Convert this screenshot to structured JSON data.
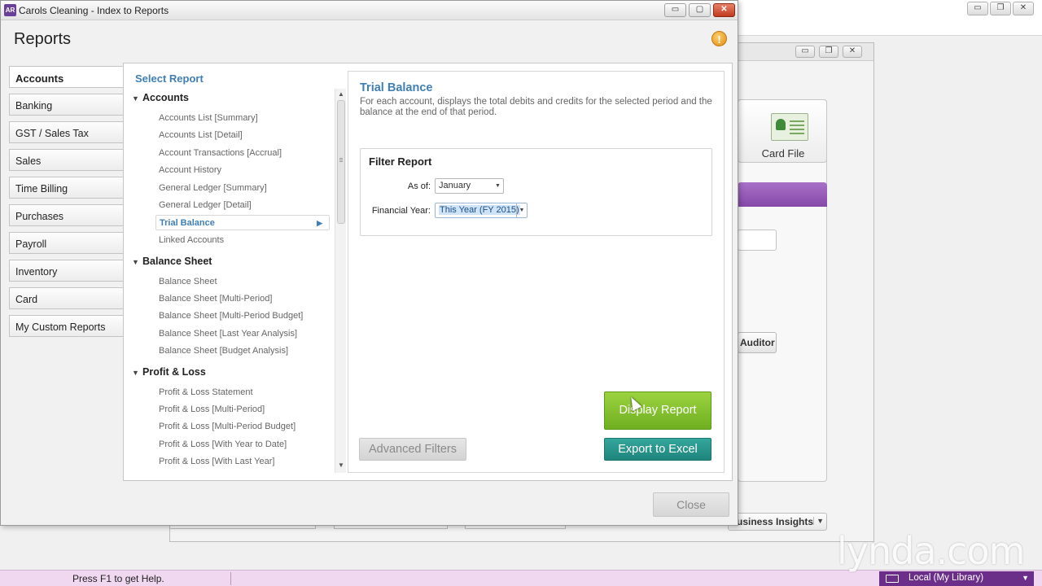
{
  "background_app": {
    "card_file_label": "Card File",
    "auditor_label": "Auditor",
    "insights_label": "usiness Insights"
  },
  "window": {
    "icon_label": "AR",
    "title": "Carols Cleaning - Index to Reports",
    "minimize": "▭",
    "maximize": "▢",
    "close": "✕"
  },
  "header": {
    "title": "Reports",
    "help_glyph": "!"
  },
  "categories": [
    {
      "label": "Accounts",
      "active": true
    },
    {
      "label": "Banking"
    },
    {
      "label": "GST / Sales Tax"
    },
    {
      "label": "Sales"
    },
    {
      "label": "Time Billing"
    },
    {
      "label": "Purchases"
    },
    {
      "label": "Payroll"
    },
    {
      "label": "Inventory"
    },
    {
      "label": "Card"
    },
    {
      "label": "My Custom Reports"
    }
  ],
  "report_list": {
    "heading": "Select Report",
    "groups": [
      {
        "label": "Accounts",
        "items": [
          "Accounts List [Summary]",
          "Accounts List [Detail]",
          "Account Transactions [Accrual]",
          "Account History",
          "General Ledger [Summary]",
          "General Ledger [Detail]",
          "Trial Balance",
          "Linked Accounts"
        ]
      },
      {
        "label": "Balance Sheet",
        "items": [
          "Balance Sheet",
          "Balance Sheet [Multi-Period]",
          "Balance Sheet [Multi-Period Budget]",
          "Balance Sheet [Last Year Analysis]",
          "Balance Sheet [Budget Analysis]"
        ]
      },
      {
        "label": "Profit & Loss",
        "items": [
          "Profit & Loss Statement",
          "Profit & Loss [Multi-Period]",
          "Profit & Loss [Multi-Period Budget]",
          "Profit & Loss [With Year to Date]",
          "Profit & Loss [With Last Year]"
        ]
      }
    ],
    "selected": "Trial Balance"
  },
  "detail": {
    "title": "Trial Balance",
    "description": "For each account, displays the total debits and credits for the selected period and the balance at the end of that period.",
    "filter": {
      "title": "Filter Report",
      "as_of_label": "As of:",
      "as_of_value": "January",
      "fy_label": "Financial Year:",
      "fy_value": "This Year (FY 2015)"
    }
  },
  "buttons": {
    "display_report": "Display Report",
    "export_excel": "Export to Excel",
    "advanced_filters": "Advanced Filters",
    "close": "Close"
  },
  "status": {
    "help_text": "Press F1 to get Help.",
    "library": "Local (My Library)"
  },
  "watermark": "lynda.com",
  "colors": {
    "accent_blue": "#3f7fb5",
    "display_green": "#7dbd2a",
    "export_teal": "#27948b",
    "status_purple": "#6b2f8a"
  }
}
